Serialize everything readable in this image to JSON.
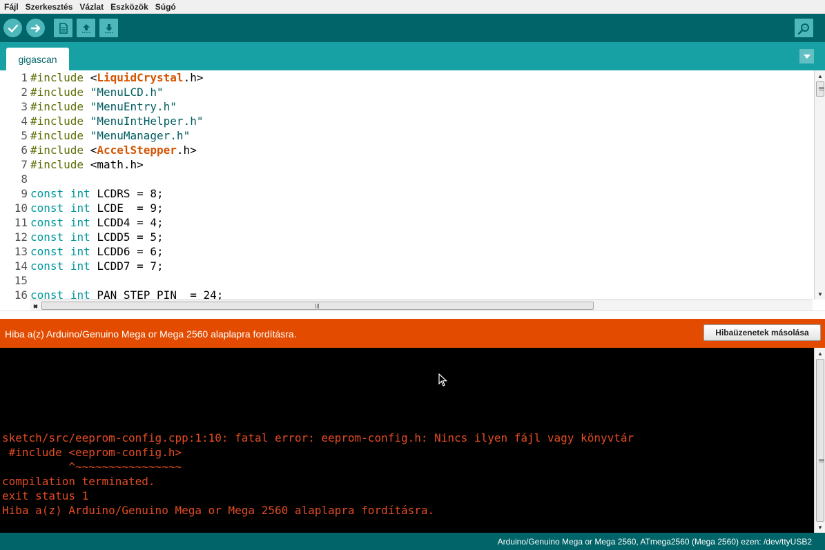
{
  "menubar": {
    "items": [
      "Fájl",
      "Szerkesztés",
      "Vázlat",
      "Eszközök",
      "Súgó"
    ]
  },
  "toolbar": {
    "buttons": [
      "verify-icon",
      "upload-icon",
      "new-icon",
      "open-icon",
      "save-icon",
      "serial-monitor-icon"
    ]
  },
  "tabs": {
    "active": "gigascan"
  },
  "editor": {
    "lines": [
      {
        "num": "1",
        "tokens": [
          {
            "t": "pp",
            "v": "#include"
          },
          {
            "t": "plain",
            "v": " <"
          },
          {
            "t": "lib",
            "v": "LiquidCrystal"
          },
          {
            "t": "plain",
            "v": ".h>"
          }
        ]
      },
      {
        "num": "2",
        "tokens": [
          {
            "t": "pp",
            "v": "#include"
          },
          {
            "t": "plain",
            "v": " "
          },
          {
            "t": "str",
            "v": "\"MenuLCD.h\""
          }
        ]
      },
      {
        "num": "3",
        "tokens": [
          {
            "t": "pp",
            "v": "#include"
          },
          {
            "t": "plain",
            "v": " "
          },
          {
            "t": "str",
            "v": "\"MenuEntry.h\""
          }
        ]
      },
      {
        "num": "4",
        "tokens": [
          {
            "t": "pp",
            "v": "#include"
          },
          {
            "t": "plain",
            "v": " "
          },
          {
            "t": "str",
            "v": "\"MenuIntHelper.h\""
          }
        ]
      },
      {
        "num": "5",
        "tokens": [
          {
            "t": "pp",
            "v": "#include"
          },
          {
            "t": "plain",
            "v": " "
          },
          {
            "t": "str",
            "v": "\"MenuManager.h\""
          }
        ]
      },
      {
        "num": "6",
        "tokens": [
          {
            "t": "pp",
            "v": "#include"
          },
          {
            "t": "plain",
            "v": " <"
          },
          {
            "t": "lib",
            "v": "AccelStepper"
          },
          {
            "t": "plain",
            "v": ".h>"
          }
        ]
      },
      {
        "num": "7",
        "tokens": [
          {
            "t": "pp",
            "v": "#include"
          },
          {
            "t": "plain",
            "v": " <math.h>"
          }
        ]
      },
      {
        "num": "8",
        "tokens": []
      },
      {
        "num": "9",
        "tokens": [
          {
            "t": "kw",
            "v": "const"
          },
          {
            "t": "plain",
            "v": " "
          },
          {
            "t": "kw",
            "v": "int"
          },
          {
            "t": "plain",
            "v": " LCDRS = 8;"
          }
        ]
      },
      {
        "num": "10",
        "tokens": [
          {
            "t": "kw",
            "v": "const"
          },
          {
            "t": "plain",
            "v": " "
          },
          {
            "t": "kw",
            "v": "int"
          },
          {
            "t": "plain",
            "v": " LCDE  = 9;"
          }
        ]
      },
      {
        "num": "11",
        "tokens": [
          {
            "t": "kw",
            "v": "const"
          },
          {
            "t": "plain",
            "v": " "
          },
          {
            "t": "kw",
            "v": "int"
          },
          {
            "t": "plain",
            "v": " LCDD4 = 4;"
          }
        ]
      },
      {
        "num": "12",
        "tokens": [
          {
            "t": "kw",
            "v": "const"
          },
          {
            "t": "plain",
            "v": " "
          },
          {
            "t": "kw",
            "v": "int"
          },
          {
            "t": "plain",
            "v": " LCDD5 = 5;"
          }
        ]
      },
      {
        "num": "13",
        "tokens": [
          {
            "t": "kw",
            "v": "const"
          },
          {
            "t": "plain",
            "v": " "
          },
          {
            "t": "kw",
            "v": "int"
          },
          {
            "t": "plain",
            "v": " LCDD6 = 6;"
          }
        ]
      },
      {
        "num": "14",
        "tokens": [
          {
            "t": "kw",
            "v": "const"
          },
          {
            "t": "plain",
            "v": " "
          },
          {
            "t": "kw",
            "v": "int"
          },
          {
            "t": "plain",
            "v": " LCDD7 = 7;"
          }
        ]
      },
      {
        "num": "15",
        "tokens": []
      },
      {
        "num": "16",
        "tokens": [
          {
            "t": "kw",
            "v": "const"
          },
          {
            "t": "plain",
            "v": " "
          },
          {
            "t": "kw",
            "v": "int"
          },
          {
            "t": "plain",
            "v": " PAN_STEP_PIN  = 24;"
          }
        ]
      }
    ]
  },
  "error_banner": {
    "message": "Hiba a(z) Arduino/Genuino Mega or Mega 2560 alaplapra fordításra.",
    "copy_label": "Hibaüzenetek másolása"
  },
  "console": {
    "lines": [
      "sketch/src/eeprom-config.cpp:1:10: fatal error: eeprom-config.h: Nincs ilyen fájl vagy könyvtár",
      " #include <eeprom-config.h>",
      "          ^~~~~~~~~~~~~~~~~",
      "compilation terminated.",
      "exit status 1",
      "Hiba a(z) Arduino/Genuino Mega or Mega 2560 alaplapra fordításra."
    ]
  },
  "statusbar": {
    "board": "Arduino/Genuino Mega or Mega 2560, ATmega2560 (Mega 2560) ezen: /dev/ttyUSB2"
  },
  "colors": {
    "toolbar": "#006468",
    "tabrow": "#17a1a5",
    "error": "#e34c00",
    "console_text": "#e34c22"
  }
}
